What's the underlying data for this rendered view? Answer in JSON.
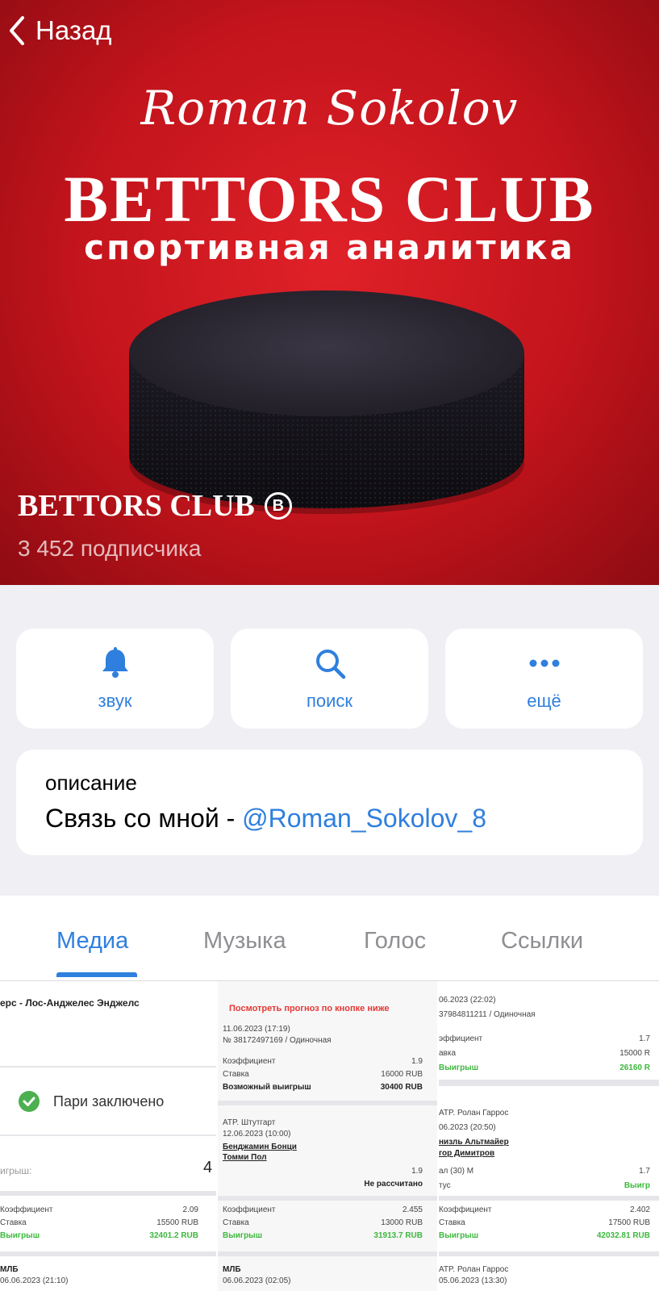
{
  "nav": {
    "back_label": "Назад"
  },
  "cover": {
    "script_name": "Roman Sokolov",
    "logo_title": "BETTORS CLUB",
    "logo_subtitle": "спортивная аналитика"
  },
  "channel": {
    "name": "BETTORS CLUB",
    "verified_mark": "B",
    "subscribers": "3 452 подписчика"
  },
  "actions": [
    {
      "label": "звук",
      "icon": "bell-icon"
    },
    {
      "label": "поиск",
      "icon": "search-icon"
    },
    {
      "label": "ещё",
      "icon": "more-icon"
    }
  ],
  "description": {
    "title": "описание",
    "text_prefix": "Связь со мной - ",
    "link": "@Roman_Sokolov_8"
  },
  "tabs": [
    {
      "label": "Медиа",
      "active": true
    },
    {
      "label": "Музыка",
      "active": false
    },
    {
      "label": "Голос",
      "active": false
    },
    {
      "label": "Ссылки",
      "active": false
    }
  ],
  "media": {
    "c1": {
      "match": "ерс - Лос-Анджелес Энджелс",
      "status": "Пари заключено",
      "winnings_partial": "игрыш:",
      "winnings_digit": "4",
      "coef_label": "Коэффициент",
      "coef_value": "2.09",
      "stake_label": "Ставка",
      "stake_value": "15500 RUB",
      "win_label": "Выигрыш",
      "win_value": "32401.2 RUB",
      "league2": "МЛБ",
      "date2": "06.06.2023 (21:10)"
    },
    "c2": {
      "banner": "Посмотреть прогноз по кнопке ниже",
      "date1": "11.06.2023 (17:19)",
      "id1": "№ 38172497169 / Одиночная",
      "coef_label": "Коэффициент",
      "coef_value": "1.9",
      "stake_label": "Ставка",
      "stake_value": "16000 RUB",
      "possible_label": "Возможный выигрыш",
      "possible_value": "30400 RUB",
      "event2": "ATP. Штутгарт",
      "date2": "12.06.2023 (10:00)",
      "player_a": "Бенджамин Бонци",
      "player_b": "Томми Пол",
      "odds2": "1.9",
      "status2": "Не рассчитано",
      "coef2": "2.455",
      "stake2": "13000 RUB",
      "win2": "31913.7 RUB",
      "win_label": "Выигрыш",
      "league3": "МЛБ",
      "date3": "06.06.2023 (02:05)"
    },
    "c3": {
      "date1": "06.2023 (22:02)",
      "id1": "37984811211 / Одиночная",
      "coef_label": "эффициент",
      "coef_value": "1.7",
      "stake_label": "авка",
      "stake_value": "15000 R",
      "win_label": "Выигрыш",
      "win_value": "26160 R",
      "event2": "ATP. Ролан Гаррос",
      "date2": "06.2023 (20:50)",
      "player_a": "низль Альтмайер",
      "player_b": "гор Димитров",
      "market": "ал (30) М",
      "odds2": "1.7",
      "status_label": "тус",
      "status_value": "Выигр",
      "coef3": "2.402",
      "stake3": "17500 RUB",
      "win3": "42032.81 RUB",
      "event3": "ATP. Ролан Гаррос",
      "date3": "05.06.2023 (13:30)"
    }
  }
}
